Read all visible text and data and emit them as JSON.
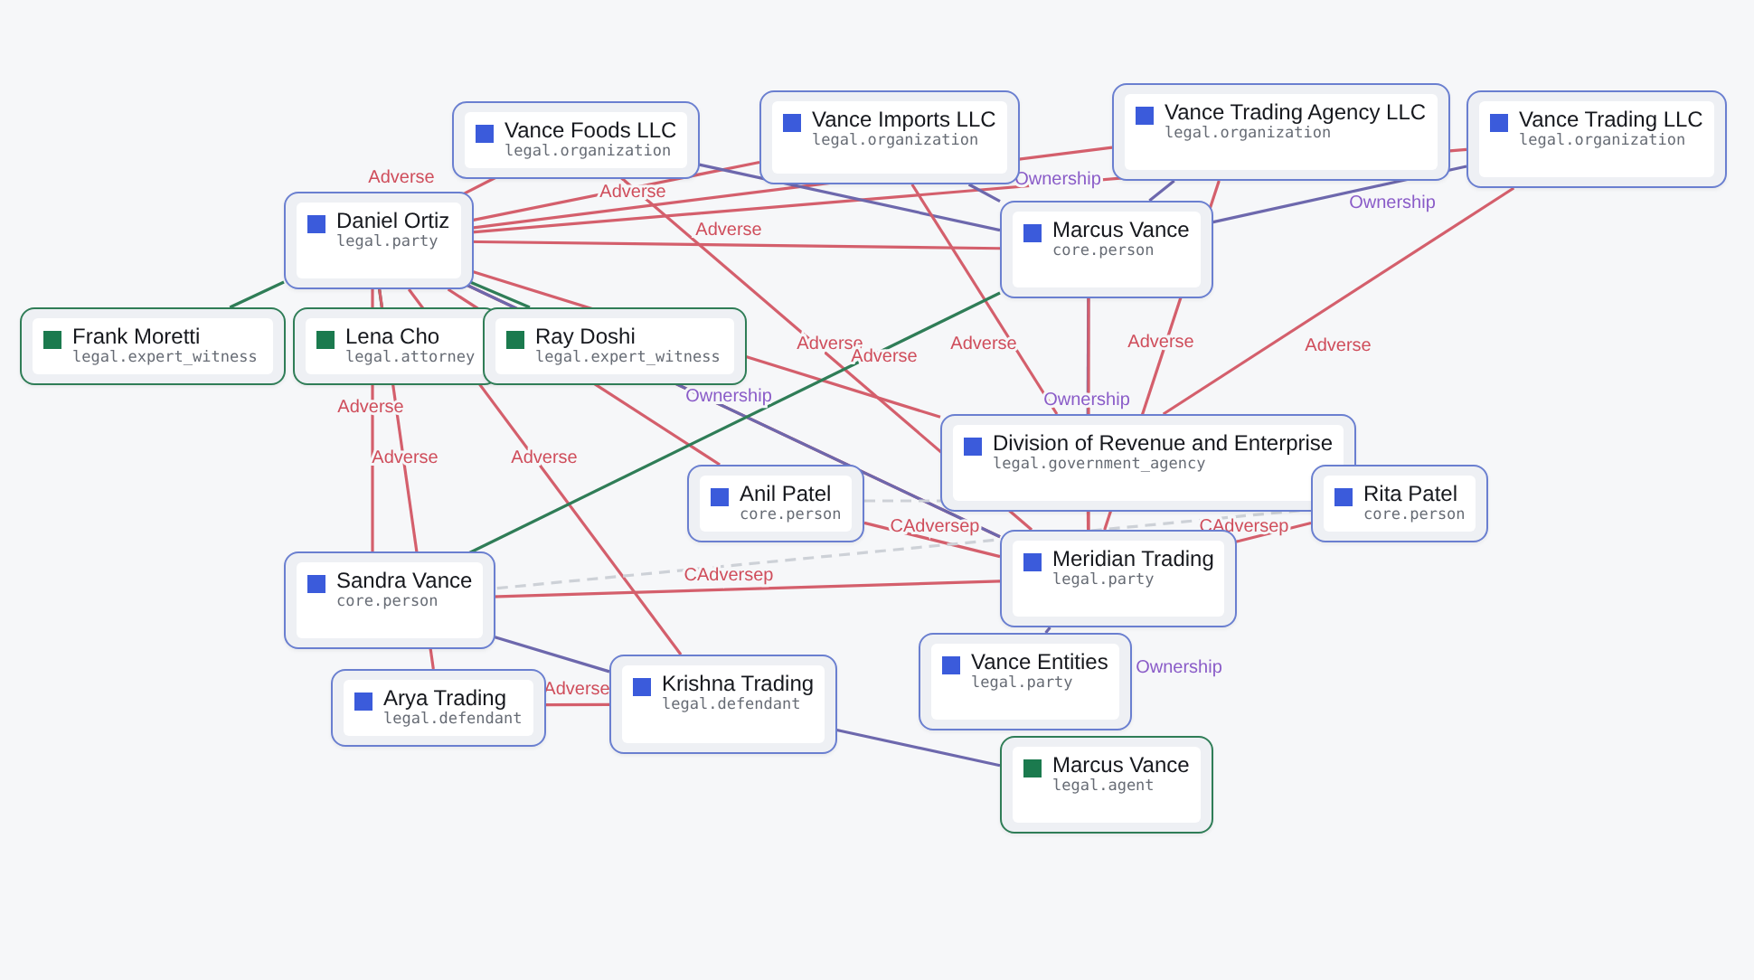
{
  "nodes": [
    {
      "title": "Vance Foods LLC",
      "subtitle": "legal.organization",
      "color": "#3b5bdb"
    },
    {
      "title": "Vance Imports LLC",
      "subtitle": "legal.organization",
      "color": "#3b5bdb"
    },
    {
      "title": "Vance Trading Agency LLC",
      "subtitle": "legal.organization",
      "color": "#3b5bdb"
    },
    {
      "title": "Vance Trading LLC",
      "subtitle": "legal.organization",
      "color": "#3b5bdb"
    },
    {
      "title": "Daniel Ortiz",
      "subtitle": "legal.party",
      "color": "#3b5bdb"
    },
    {
      "title": "Marcus Vance",
      "subtitle": "core.person",
      "color": "#3b5bdb"
    },
    {
      "title": "Frank Moretti",
      "subtitle": "legal.expert_witness",
      "color": "#1b7a4e"
    },
    {
      "title": "Lena Cho",
      "subtitle": "legal.attorney",
      "color": "#1b7a4e"
    },
    {
      "title": "Ray Doshi",
      "subtitle": "legal.expert_witness",
      "color": "#1b7a4e"
    },
    {
      "title": "Division of Revenue and Enterprise",
      "subtitle": "legal.government_agency",
      "color": "#3b5bdb"
    },
    {
      "title": "Anil Patel",
      "subtitle": "core.person",
      "color": "#3b5bdb"
    },
    {
      "title": "Rita Patel",
      "subtitle": "core.person",
      "color": "#3b5bdb"
    },
    {
      "title": "Sandra Vance",
      "subtitle": "core.person",
      "color": "#3b5bdb"
    },
    {
      "title": "Meridian Trading",
      "subtitle": "legal.party",
      "color": "#3b5bdb"
    },
    {
      "title": "Vance Entities",
      "subtitle": "legal.party",
      "color": "#3b5bdb"
    },
    {
      "title": "Arya Trading",
      "subtitle": "legal.defendant",
      "color": "#3b5bdb"
    },
    {
      "title": "Krishna Trading",
      "subtitle": "legal.defendant",
      "color": "#3b5bdb"
    },
    {
      "title": "Marcus Vance",
      "subtitle": "legal.agent",
      "color": "#1b7a4e"
    }
  ],
  "edges": [
    {
      "kind": "adverse",
      "label": "Adverse"
    },
    {
      "kind": "adverse"
    },
    {
      "kind": "adverse"
    },
    {
      "kind": "adverse"
    },
    {
      "kind": "adverse",
      "label": "Adverse"
    },
    {
      "kind": "link"
    },
    {
      "kind": "link"
    },
    {
      "kind": "link"
    },
    {
      "kind": "adverse",
      "label": "Adverse"
    },
    {
      "kind": "adverse",
      "label": "Adverse"
    },
    {
      "kind": "adverse",
      "label": "Adverse"
    },
    {
      "kind": "adverse",
      "label": "Adverse"
    },
    {
      "kind": "adverse",
      "label": "Adverse"
    },
    {
      "kind": "adverse"
    },
    {
      "kind": "ownership",
      "label": "Ownership"
    },
    {
      "kind": "ownership"
    },
    {
      "kind": "adverse",
      "label": "Adverse"
    },
    {
      "kind": "adverse",
      "label": "Adverse"
    },
    {
      "kind": "ownership",
      "label": "Ownership"
    },
    {
      "kind": "adverse",
      "label": "Adverse"
    },
    {
      "kind": "ownership",
      "label": "Ownership"
    },
    {
      "kind": "adverse",
      "label": "Adverse"
    },
    {
      "kind": "ownership",
      "label": "Ownership"
    },
    {
      "kind": "link"
    },
    {
      "kind": "adverse"
    },
    {
      "kind": "adverse"
    },
    {
      "kind": "adverse"
    },
    {
      "kind": "adverse",
      "label": "CAdversep"
    },
    {
      "kind": "related"
    },
    {
      "kind": "adverse",
      "label": "CAdversep"
    },
    {
      "kind": "related"
    },
    {
      "kind": "ownership"
    },
    {
      "kind": "adverse",
      "label": "CAdversep"
    },
    {
      "kind": "adverse",
      "label": "Adverse"
    },
    {
      "kind": "ownership",
      "label": "Ownership"
    },
    {
      "kind": "ownership"
    },
    {
      "kind": "ownership"
    }
  ]
}
